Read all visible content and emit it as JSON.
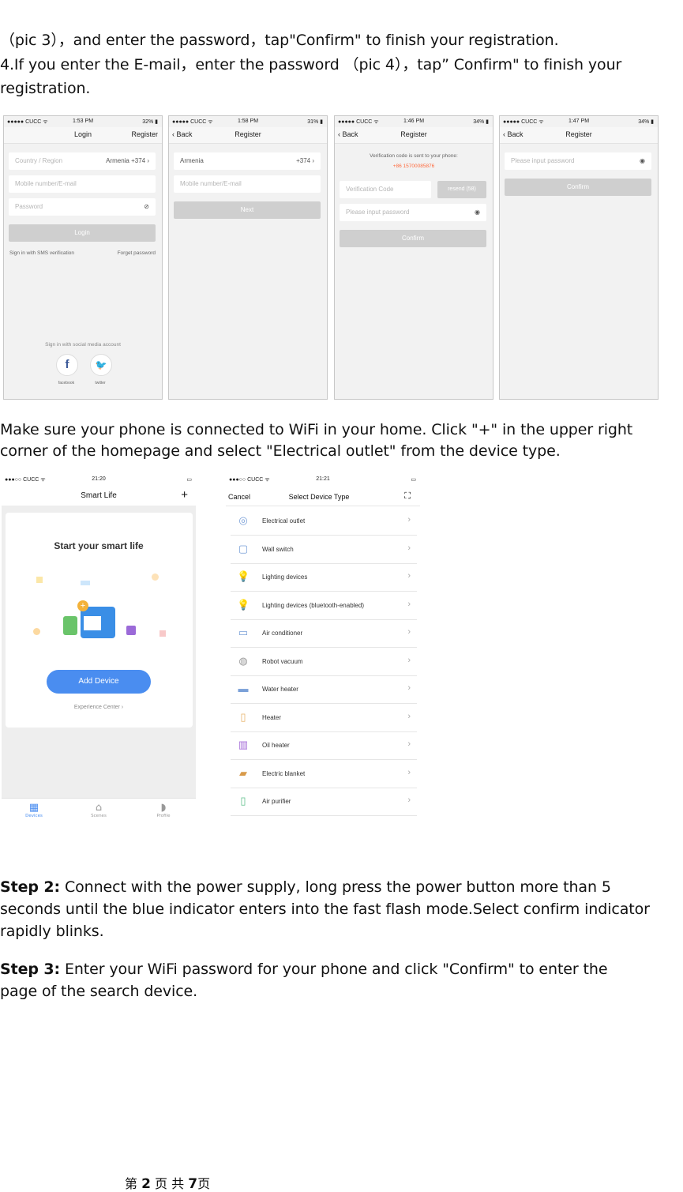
{
  "text": {
    "line1": "（pic 3），and enter the password，tap\"Confirm\" to finish your registration.",
    "line2": "4.If you enter the E-mail，enter the password （pic 4），tap” Confirm\" to finish your",
    "line3": "registration.",
    "wifi1": "Make sure your phone is connected to WiFi in your home. Click \"+\" in the upper right",
    "wifi2": "corner of the homepage and select \"Electrical outlet\" from the device type.",
    "step2_label": "Step 2:",
    "step2_1": " Connect with the power supply, long press the power button more than 5",
    "step2_2": "seconds until the blue indicator enters into the fast flash mode.Select confirm indicator",
    "step2_3": "rapidly blinks.",
    "step3_label": "Step 3:",
    "step3_1": " Enter your WiFi password for your phone and click \"Confirm\" to enter the",
    "step3_2": "page of the search device."
  },
  "footer": {
    "prefix": "第",
    "page": "2",
    "mid": "页    共",
    "total": "7",
    "suffix": "页"
  },
  "screens": {
    "s1": {
      "carrier": "●●●●● CUCC ᯤ",
      "time": "1:53 PM",
      "battery": "32% ▮",
      "title": "Login",
      "right": "Register",
      "country": "Country / Region",
      "country_val": "Armenia +374 ›",
      "mobile": "Mobile number/E-mail",
      "password": "Password",
      "login": "Login",
      "sms": "Sign in with SMS verification",
      "forgot": "Forget password",
      "social": "Sign in with social media account",
      "fb": "facebook",
      "tw": "twitter"
    },
    "s2": {
      "carrier": "●●●●● CUCC ᯤ",
      "time": "1:58 PM",
      "battery": "31% ▮",
      "back": "‹ Back",
      "title": "Register",
      "country": "Armenia",
      "code": "+374 ›",
      "mobile": "Mobile number/E-mail",
      "next": "Next"
    },
    "s3": {
      "carrier": "●●●●● CUCC ᯤ",
      "time": "1:46 PM",
      "battery": "34% ▮",
      "back": "‹ Back",
      "title": "Register",
      "msg": "Verification code is sent to your phone:",
      "phone": "+86 15700085876",
      "vcode": "Verification Code",
      "resend": "resend (58)",
      "pwd": "Please input password",
      "confirm": "Confirm"
    },
    "s4": {
      "carrier": "●●●●● CUCC ᯤ",
      "time": "1:47 PM",
      "battery": "34% ▮",
      "back": "‹ Back",
      "title": "Register",
      "pwd": "Please input password",
      "confirm": "Confirm"
    },
    "s5": {
      "carrier": "●●●○○ CUCC ᯤ",
      "time": "21:20",
      "battery": "▭",
      "title": "Smart Life",
      "plus": "+",
      "headline": "Start your smart life",
      "add": "Add Device",
      "exp": "Experience Center ›",
      "tab1": "Devices",
      "tab2": "Scenes",
      "tab3": "Profile"
    },
    "s6": {
      "carrier": "●●●○○ CUCC ᯤ",
      "time": "21:21",
      "battery": "▭",
      "cancel": "Cancel",
      "title": "Select Device Type",
      "items": [
        "Electrical outlet",
        "Wall switch",
        "Lighting devices",
        "Lighting devices (bluetooth-enabled)",
        "Air conditioner",
        "Robot vacuum",
        "Water heater",
        "Heater",
        "Oil heater",
        "Electric blanket",
        "Air purifier"
      ]
    }
  }
}
